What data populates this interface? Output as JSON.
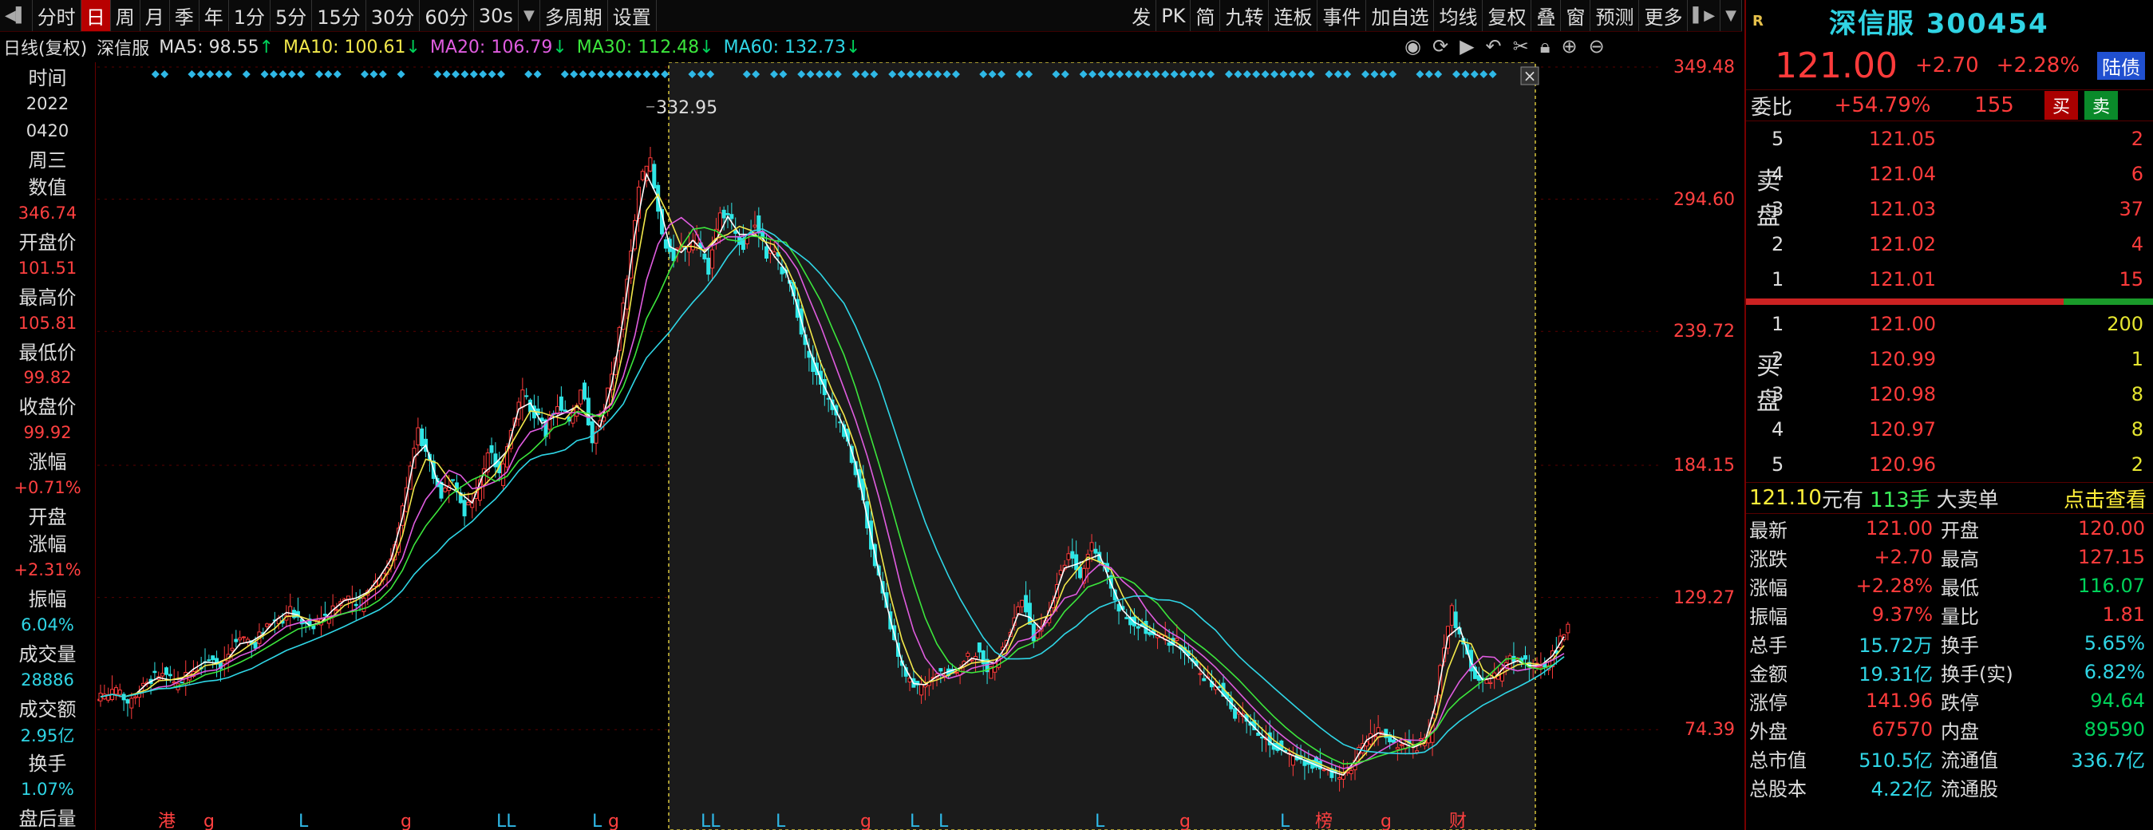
{
  "toolbar": {
    "items": [
      "分时",
      "日",
      "周",
      "月",
      "季",
      "年",
      "1分",
      "5分",
      "15分",
      "30分",
      "60分",
      "30s"
    ],
    "active_index": 1,
    "more_period": "多周期",
    "settings": "设置",
    "right_items": [
      "发",
      "PK",
      "简",
      "九转",
      "连板",
      "事件",
      "加自选",
      "均线",
      "复权",
      "叠",
      "窗",
      "预测",
      "更多"
    ]
  },
  "ma_line": {
    "label": "日线(复权)",
    "name": "深信服",
    "ma5": "MA5: 98.55",
    "ma10": "MA10: 100.61",
    "ma20": "MA20: 106.79",
    "ma30": "MA30: 112.48",
    "ma60": "MA60: 132.73"
  },
  "left_panel": {
    "time_label": "时间",
    "year": "2022",
    "date": "0420",
    "weekday": "周三",
    "value_label": "数值",
    "value": "346.74",
    "open_label": "开盘价",
    "open": "101.51",
    "high_label": "最高价",
    "high": "105.81",
    "low_label": "最低价",
    "low": "99.82",
    "close_label": "收盘价",
    "close": "99.92",
    "change_label": "涨幅",
    "change": "+0.71%",
    "open_change_label1": "开盘",
    "open_change_label2": "涨幅",
    "open_change": "+2.31%",
    "amplitude_label": "振幅",
    "amplitude": "6.04%",
    "volume_label": "成交量",
    "volume": "28886",
    "amount_label": "成交额",
    "amount": "2.95亿",
    "turnover_label": "换手",
    "turnover": "1.07%",
    "after_label": "盘后量"
  },
  "chart_data": {
    "type": "candlestick",
    "y_ticks": [
      "349.48",
      "294.60",
      "239.72",
      "184.15",
      "129.27",
      "74.39"
    ],
    "ylim": [
      40,
      349.48
    ],
    "peak_label": "332.95",
    "event_markers": [
      "港",
      "g",
      "L",
      "g",
      "LL",
      "L",
      "g",
      "LL",
      "L",
      "g",
      "L",
      "L",
      "L",
      "g",
      "L",
      "榜",
      "g",
      "财"
    ],
    "close_series": [
      88,
      90,
      86,
      92,
      95,
      97,
      93,
      98,
      101,
      104,
      100,
      108,
      112,
      110,
      118,
      121,
      125,
      119,
      116,
      122,
      126,
      130,
      128,
      135,
      140,
      150,
      175,
      200,
      185,
      170,
      180,
      165,
      172,
      190,
      180,
      200,
      215,
      205,
      198,
      210,
      202,
      215,
      195,
      205,
      230,
      260,
      300,
      310,
      280,
      270,
      275,
      280,
      265,
      290,
      285,
      275,
      285,
      272,
      270,
      260,
      240,
      225,
      215,
      205,
      195,
      175,
      150,
      130,
      110,
      95,
      92,
      94,
      99,
      98,
      102,
      106,
      100,
      104,
      115,
      130,
      112,
      120,
      135,
      148,
      138,
      152,
      142,
      128,
      120,
      118,
      115,
      112,
      110,
      106,
      100,
      95,
      90,
      84,
      80,
      74,
      70,
      66,
      64,
      62,
      60,
      58,
      56,
      55,
      68,
      72,
      74,
      70,
      68,
      66,
      72,
      100,
      126,
      108,
      96,
      94,
      98,
      104,
      102,
      100,
      102,
      108,
      118
    ]
  },
  "right_panel": {
    "r_mark": "R",
    "name": "深信服 300454",
    "price": "121.00",
    "change": "+2.70",
    "change_pct": "+2.28%",
    "badge": "陆债",
    "weibi_label": "委比",
    "weibi": "+54.79%",
    "weicha": "155",
    "buy_btn": "买",
    "sell_btn": "卖",
    "sell_title": "卖盘",
    "buy_title": "买盘",
    "sells": [
      {
        "lv": "5",
        "price": "121.05",
        "qty": "2"
      },
      {
        "lv": "4",
        "price": "121.04",
        "qty": "6"
      },
      {
        "lv": "3",
        "price": "121.03",
        "qty": "37"
      },
      {
        "lv": "2",
        "price": "121.02",
        "qty": "4"
      },
      {
        "lv": "1",
        "price": "121.01",
        "qty": "15"
      }
    ],
    "buys": [
      {
        "lv": "1",
        "price": "121.00",
        "qty": "200"
      },
      {
        "lv": "2",
        "price": "120.99",
        "qty": "1"
      },
      {
        "lv": "3",
        "price": "120.98",
        "qty": "8"
      },
      {
        "lv": "4",
        "price": "120.97",
        "qty": "8"
      },
      {
        "lv": "5",
        "price": "120.96",
        "qty": "2"
      }
    ],
    "big_order": {
      "price": "121.10",
      "unit": "元有",
      "hands": "113手",
      "label": "大卖单",
      "click": "点击查看"
    },
    "quotes": [
      [
        "最新",
        "121.00",
        "red",
        "开盘",
        "120.00",
        "red"
      ],
      [
        "涨跌",
        "+2.70",
        "red",
        "最高",
        "127.15",
        "red"
      ],
      [
        "涨幅",
        "+2.28%",
        "red",
        "最低",
        "116.07",
        "green"
      ],
      [
        "振幅",
        "9.37%",
        "red",
        "量比",
        "1.81",
        "red"
      ],
      [
        "总手",
        "15.72万",
        "cyan",
        "换手",
        "5.65%",
        "cyan"
      ],
      [
        "金额",
        "19.31亿",
        "cyan",
        "换手(实)",
        "6.82%",
        "cyan"
      ],
      [
        "涨停",
        "141.96",
        "red",
        "跌停",
        "94.64",
        "green"
      ],
      [
        "外盘",
        "67570",
        "red",
        "内盘",
        "89590",
        "green"
      ],
      [
        "总市值",
        "510.5亿",
        "cyan",
        "流通值",
        "336.7亿",
        "cyan"
      ],
      [
        "总股本",
        "4.22亿",
        "cyan",
        "流通股",
        "",
        "cyan"
      ]
    ]
  }
}
